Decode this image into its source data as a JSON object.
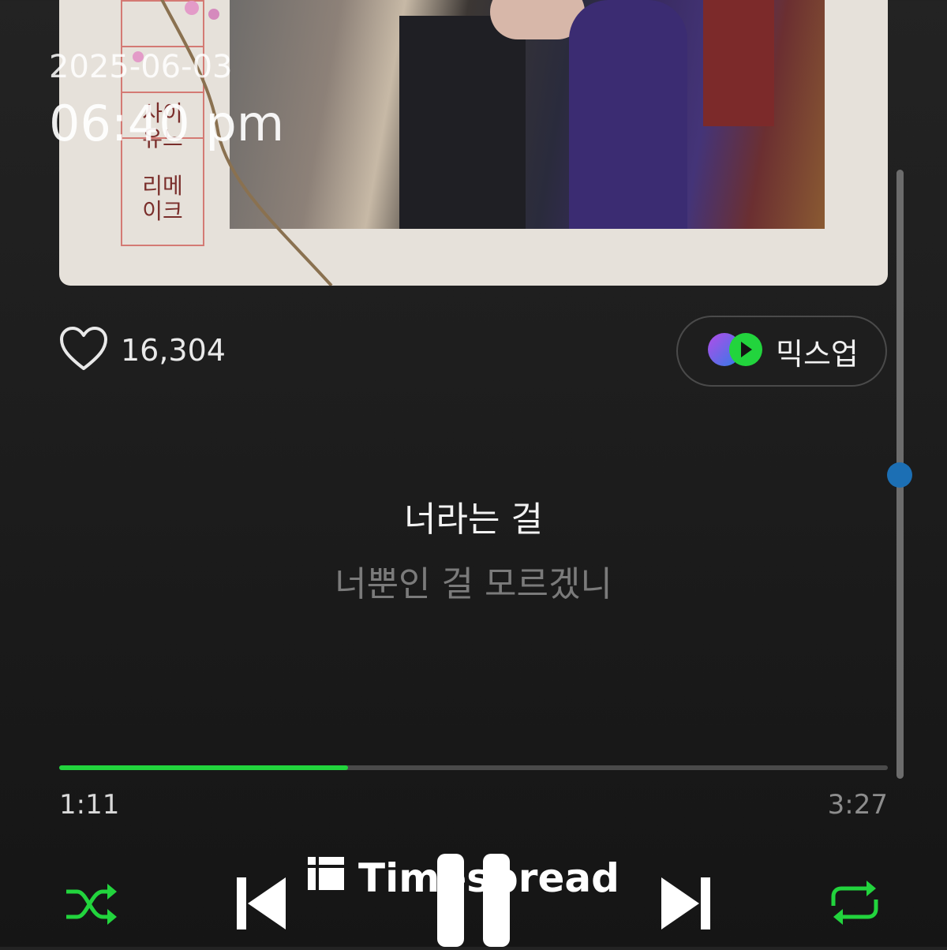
{
  "status": {
    "date": "2025-06-03",
    "time": "06:40 pm"
  },
  "album": {
    "title_lines": [
      "사이",
      "유느",
      "리메",
      "이크"
    ]
  },
  "like": {
    "count": "16,304"
  },
  "mixup": {
    "label": "믹스업"
  },
  "lyrics": {
    "current": "너라는 걸",
    "next": "너뿐인 걸 모르겠니"
  },
  "playback": {
    "elapsed": "1:11",
    "total": "3:27",
    "progress_fraction": 0.349
  },
  "colors": {
    "accent_green": "#22d43d",
    "scroll_thumb": "#1c6fb4"
  },
  "watermark": {
    "text": "Timespread"
  },
  "controls": {
    "shuffle_icon": "shuffle-icon",
    "previous_icon": "skip-previous-icon",
    "pause_icon": "pause-icon",
    "next_icon": "skip-next-icon",
    "repeat_icon": "repeat-icon"
  }
}
